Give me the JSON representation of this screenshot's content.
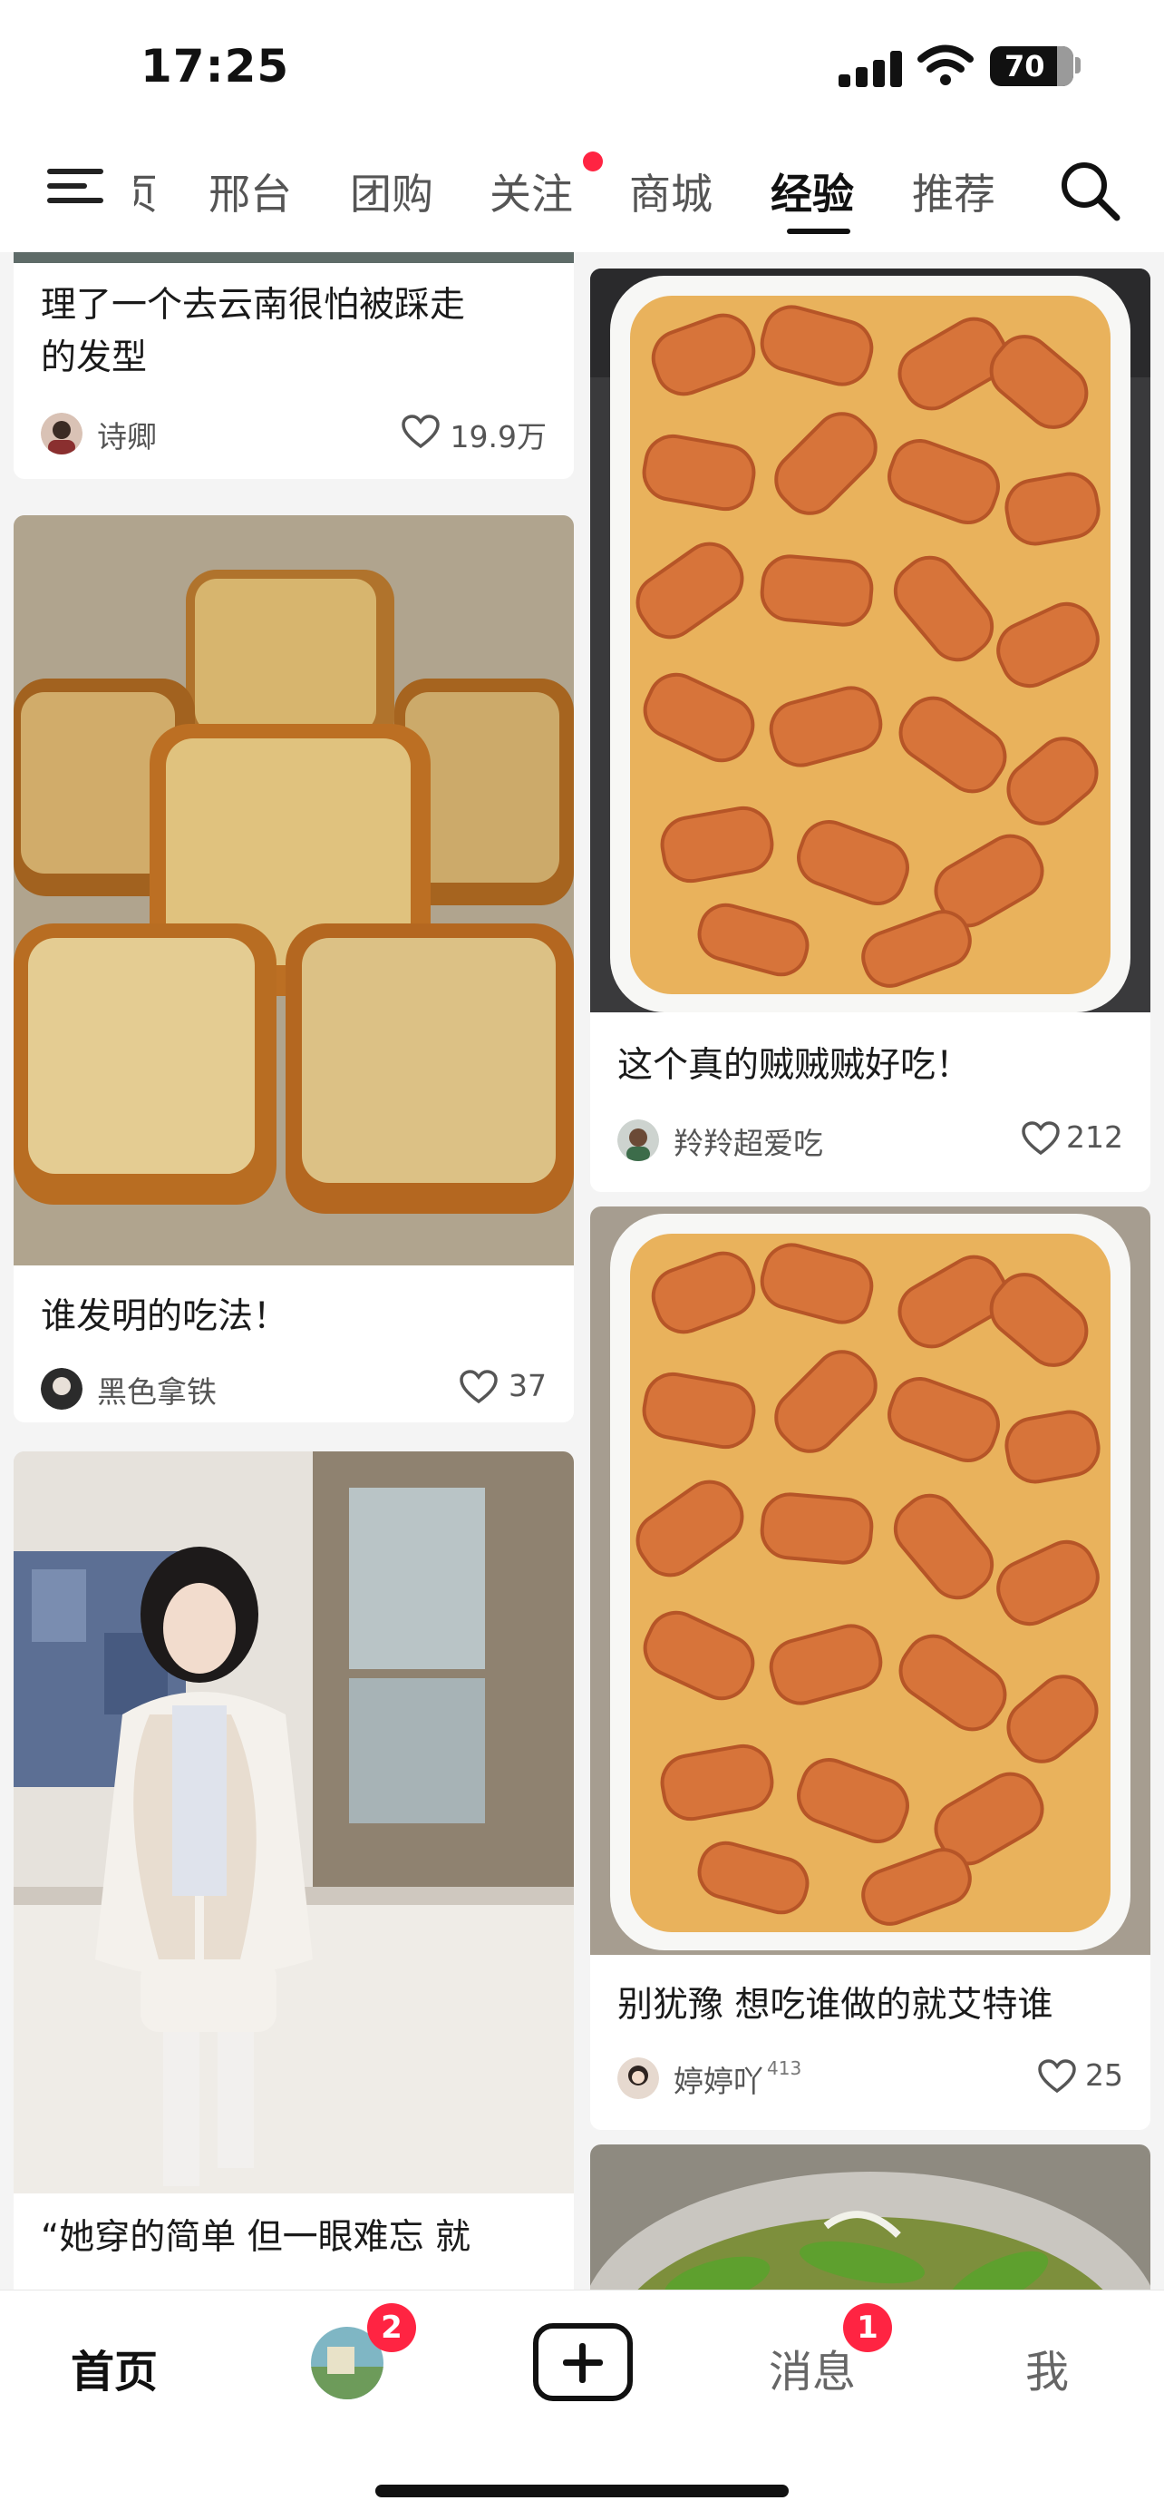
{
  "status_bar": {
    "time": "17:25",
    "battery": "70"
  },
  "top_nav": {
    "clipped_tab": "页",
    "tabs": [
      {
        "label": "邢台"
      },
      {
        "label": "团购"
      },
      {
        "label": "关注"
      },
      {
        "label": "商城"
      },
      {
        "label": "经验",
        "active": true
      },
      {
        "label": "推荐"
      }
    ]
  },
  "feed": {
    "left": [
      {
        "title_lines": [
          "理了一个去云南很怕被踩走",
          "的发型"
        ],
        "author": "诗卿",
        "likes": "19.9万"
      },
      {
        "title_lines": [
          "谁发明的吃法！"
        ],
        "author": "黑色拿铁",
        "likes": "37"
      },
      {
        "title_lines": [
          "“她穿的简单 但一眼难忘 就"
        ],
        "author": "",
        "likes": ""
      }
    ],
    "right": [
      {
        "title_lines": [
          "这个真的贼贼贼好吃！"
        ],
        "author": "羚羚超爱吃",
        "likes": "212"
      },
      {
        "title_lines": [
          "别犹豫 想吃谁做的就艾特谁"
        ],
        "author": "婷婷吖",
        "author_badge": "413",
        "likes": "25"
      }
    ]
  },
  "tab_bar": {
    "home": "首页",
    "avatar_badge": "2",
    "messages": "消息",
    "messages_badge": "1",
    "me": "我"
  },
  "colors": {
    "accent": "#ff2442",
    "background": "#f4f4f4",
    "text": "#1a1a1a"
  }
}
